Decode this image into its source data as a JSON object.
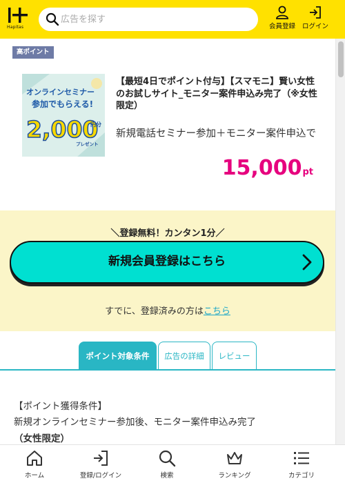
{
  "header": {
    "logo_text": "Hapitas",
    "search_placeholder": "広告を探す",
    "register_label": "会員登録",
    "login_label": "ログイン"
  },
  "badge": "高ポイント",
  "ad": {
    "image_text": {
      "line1": "オンラインセミナー",
      "line2": "参加でもらえる!",
      "amount": "2,000",
      "unit": "円分",
      "present": "プレゼント"
    },
    "title": "【最短4日でポイント付与】【スマモニ】賢い女性のお試しサイト_モニター案件申込み完了（※女性限定）",
    "description": "新規電話セミナー参加＋モニター案件申込で",
    "points": "15,000",
    "points_unit": "pt"
  },
  "registration": {
    "lead": "＼登録無料！カンタン1分／",
    "button_label": "新規会員登録はこちら",
    "note_prefix": "すでに、登録済みの方は",
    "note_link": "こちら"
  },
  "tabs": [
    {
      "label": "ポイント対象条件",
      "active": true
    },
    {
      "label": "広告の詳細",
      "active": false
    },
    {
      "label": "レビュー",
      "active": false
    }
  ],
  "conditions": {
    "heading": "【ポイント獲得条件】",
    "body": "新規オンラインセミナー参加後、モニター案件申込み完了",
    "emphasis": "（女性限定）"
  },
  "bottom_nav": [
    {
      "label": "ホーム",
      "icon": "home-icon"
    },
    {
      "label": "登録/ログイン",
      "icon": "login-icon"
    },
    {
      "label": "検索",
      "icon": "search-icon"
    },
    {
      "label": "ランキング",
      "icon": "crown-icon"
    },
    {
      "label": "カテゴリ",
      "icon": "list-icon"
    }
  ],
  "colors": {
    "header": "#ffe100",
    "accent_pink": "#e6007e",
    "cta": "#00e0d1",
    "tab": "#29b6c4",
    "reg_bg": "#fbf5c8"
  }
}
